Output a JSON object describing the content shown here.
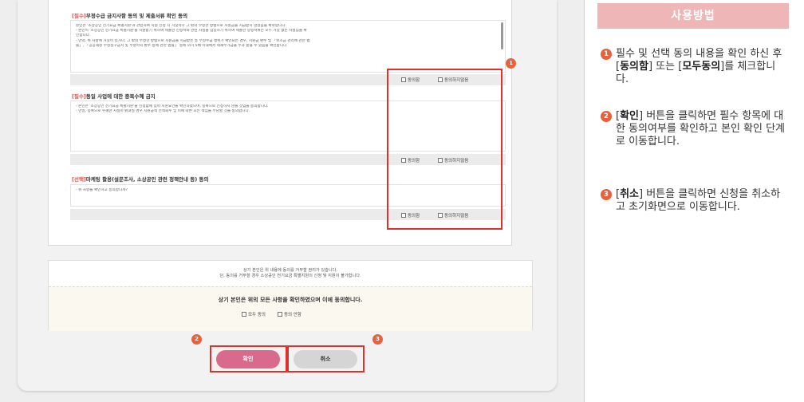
{
  "sections": [
    {
      "tag": "[필수]",
      "title": "부정수급 금지사항 동의 및 제출서류 확인 동의",
      "lines": [
        "본인은 '소상공인 전기요금 특별지원'과 관련하여 지원 신청 시 거짓이나 그 밖의 부정한 방법으로 지원금을 지급받지 않겠음을 확약합니다.",
        "- 본인이 '소상공인 전기요금 특별지원'을 지원받기 위하여 제출한 신청서와 관련 사실을 입증하기 위하여 제출한 증빙서류는 모두 거짓 없는 사실임을 확",
        "인합니다.",
        "- 만약, 위 사항에 거짓이 있거나, 그 밖의 부정한 방법으로 지원금을 지급받는 등 부정수급 행위가 확인되는 경우, 지원금 환수 및 「보조금 관리에 관한 법",
        "률」, 「공공재정 부정청구금지 및 부정이익 환수 등에 관한 법률」 등에 의거 5배 이내에서 제재부가금을 부과 받을 수 있음을 확인합니다."
      ],
      "agree_label": "동의함",
      "disagree_label": "동의하지않음"
    },
    {
      "tag": "[필수]",
      "title": "동일 사업에 대한 중복수혜 금지",
      "lines": [
        "- 본인은 '소상공인 전기요금 특별지원'을 신청함에 있어 지원요건을 확인하였으며, 중복으로 신청하지 않을 것임을 동의합니다.",
        "- 만일, 중복으로 수혜한 사실이 밝혀질 경우 지원금액 전액회수 및 이에 따른 모든 책임을 부담할 것을 동의합니다."
      ],
      "agree_label": "동의함",
      "disagree_label": "동의하지않음"
    },
    {
      "tag": "[선택]",
      "title": "마케팅 활용(설문조사, 소상공인 관련 정책안내 등) 동의",
      "lines": [
        "- 위 사항을 확인하고 동의합니까?"
      ],
      "agree_label": "동의함",
      "disagree_label": "동의하지않음"
    }
  ],
  "notice": {
    "line1": "상기 본인은 위 내용에 동의를 거부할 권리가 있습니다.",
    "line2": "단, 동의를 거부할 경우 소상공인 전기요금 특별지원의 신청 및 지원이 불가합니다.",
    "confirm": "상기 본인은 위의 모든 사항을 확인하였으며 이에 동의합니다.",
    "all_agree": "모두 동의",
    "no_agree": "동의 안함"
  },
  "buttons": {
    "ok": "확인",
    "cancel": "취소"
  },
  "markers": [
    "1",
    "2",
    "3"
  ],
  "guide": {
    "title": "사용방법",
    "steps": [
      {
        "num": "1",
        "pre": "필수 및 선택 동의 내용을 확인 하신 후 [",
        "b1": "동의함",
        "mid": "] 또는 [",
        "b2": "모두동의",
        "post": "]를 체크합니다."
      },
      {
        "num": "2",
        "pre": "[",
        "b1": "확인",
        "post": "] 버튼을 클릭하면 필수 항목에 대한 동의여부를 확인하고 본인 확인 단계로 이동합니다."
      },
      {
        "num": "3",
        "pre": "[",
        "b1": "취소",
        "post": "] 버튼을 클릭하면 신청을 취소하고 초기화면으로 이동합니다."
      }
    ]
  },
  "colors": {
    "accent_red": "#e0302c",
    "marker": "#e8613c",
    "ok_button": "#d96a8e",
    "guide_header": "#efb6b7"
  }
}
